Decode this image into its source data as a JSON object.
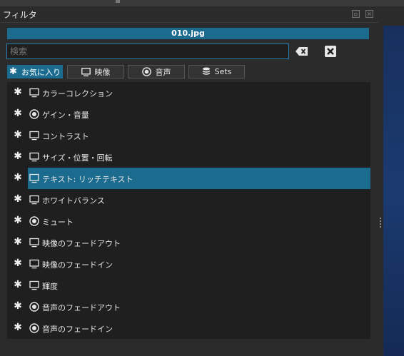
{
  "window": {
    "title": "フィルタ"
  },
  "file": {
    "name": "010.jpg"
  },
  "search": {
    "value": "",
    "placeholder": "検索"
  },
  "tabs": [
    {
      "label": "お気に入り",
      "icon": "asterisk-icon",
      "active": true
    },
    {
      "label": "映像",
      "icon": "monitor-icon",
      "active": false
    },
    {
      "label": "音声",
      "icon": "audio-icon",
      "active": false
    },
    {
      "label": "Sets",
      "icon": "stack-icon",
      "active": false
    }
  ],
  "filters": [
    {
      "label": "カラーコレクション",
      "icon": "monitor-icon",
      "selected": false
    },
    {
      "label": "ゲイン・音量",
      "icon": "audio-icon",
      "selected": false
    },
    {
      "label": "コントラスト",
      "icon": "monitor-icon",
      "selected": false
    },
    {
      "label": "サイズ・位置・回転",
      "icon": "monitor-icon",
      "selected": false
    },
    {
      "label": "テキスト: リッチテキスト",
      "icon": "monitor-icon",
      "selected": true
    },
    {
      "label": "ホワイトバランス",
      "icon": "monitor-icon",
      "selected": false
    },
    {
      "label": "ミュート",
      "icon": "audio-icon",
      "selected": false
    },
    {
      "label": "映像のフェードアウト",
      "icon": "monitor-icon",
      "selected": false
    },
    {
      "label": "映像のフェードイン",
      "icon": "monitor-icon",
      "selected": false
    },
    {
      "label": "輝度",
      "icon": "monitor-icon",
      "selected": false
    },
    {
      "label": "音声のフェードアウト",
      "icon": "audio-icon",
      "selected": false
    },
    {
      "label": "音声のフェードイン",
      "icon": "audio-icon",
      "selected": false
    }
  ],
  "colors": {
    "accent": "#1b6b8e",
    "focus": "#2a82b4",
    "list_bg": "#1f1f1f"
  }
}
